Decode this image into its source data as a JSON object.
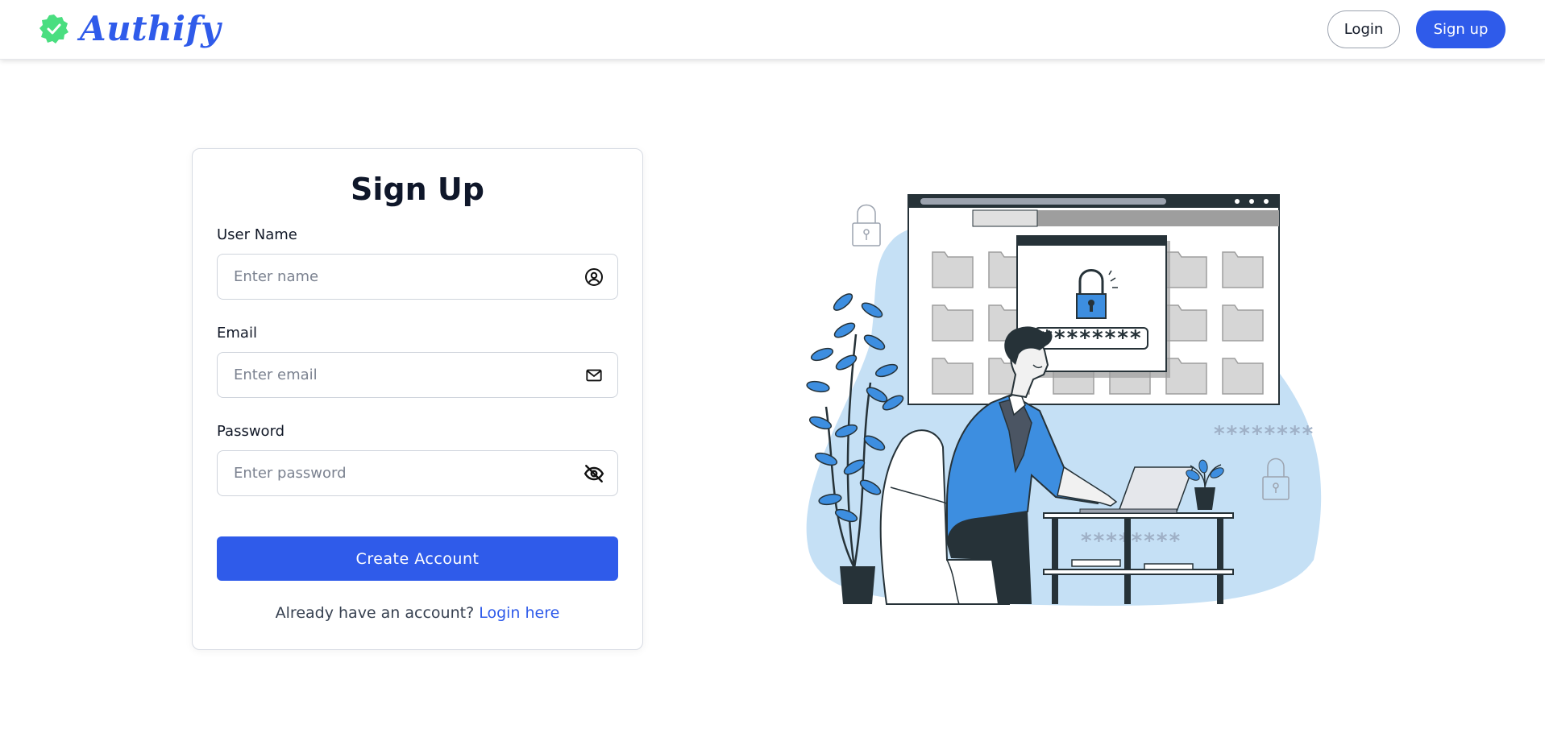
{
  "header": {
    "brand": "Authify",
    "login_label": "Login",
    "signup_label": "Sign up"
  },
  "form": {
    "title": "Sign Up",
    "username": {
      "label": "User Name",
      "placeholder": "Enter name",
      "value": ""
    },
    "email": {
      "label": "Email",
      "placeholder": "Enter email",
      "value": ""
    },
    "password": {
      "label": "Password",
      "placeholder": "Enter password",
      "value": ""
    },
    "submit_label": "Create Account",
    "footer_text": "Already have an account? ",
    "footer_link": "Login here"
  },
  "illustration": {
    "masked_password": "********",
    "background_stars_1": "********",
    "background_stars_2": "********"
  },
  "colors": {
    "accent": "#2f5bea",
    "badge_green": "#4ade80",
    "blob_blue": "#c5e0f5",
    "illustration_blue": "#3d8ee0"
  },
  "icons": {
    "logo_badge": "verified-badge-icon",
    "username_field": "user-circle-icon",
    "email_field": "mail-icon",
    "password_field": "eye-off-icon"
  }
}
